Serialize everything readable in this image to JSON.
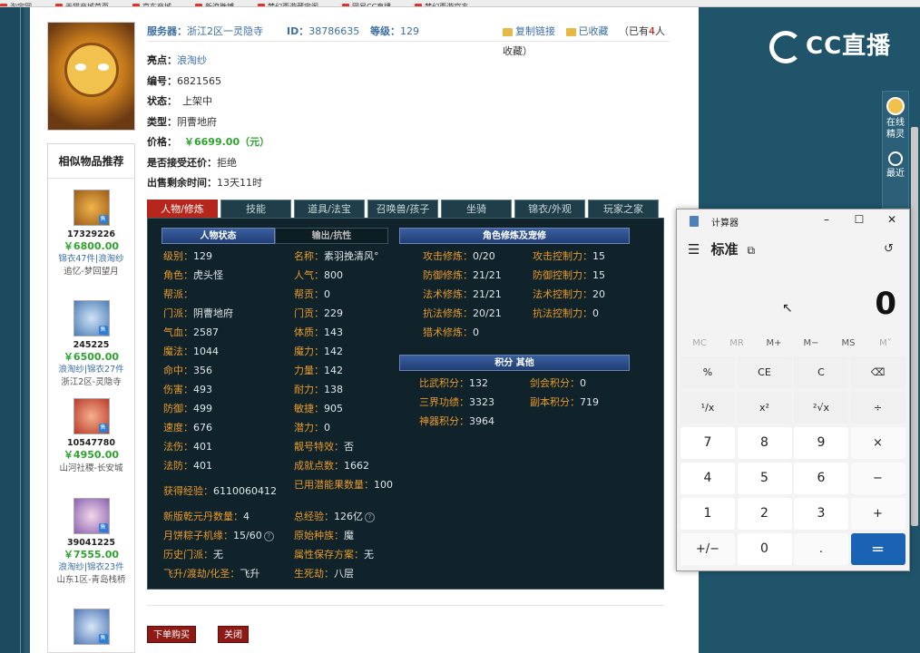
{
  "bookmarks": [
    {
      "label": "淘宝网"
    },
    {
      "label": "天猫商城首页"
    },
    {
      "label": "京东商城"
    },
    {
      "label": "新浪微博"
    },
    {
      "label": "梦幻西游藏宝阁"
    },
    {
      "label": "网易CC直播"
    },
    {
      "label": "梦幻西游官方"
    }
  ],
  "info": {
    "server_label": "服务器：",
    "server_value": "浙江2区一灵隐寺",
    "id_label": "ID：",
    "id_value": "38786635",
    "level_label": "等级：",
    "level_value": "129",
    "copy_link": "复制链接",
    "favorited": "已收藏",
    "fav_count_pre": "（已有",
    "fav_count_num": "4",
    "fav_count_post": "人收藏）",
    "highlight_label": "亮点：",
    "highlight_value": "浪淘纱",
    "number_label": "编号：",
    "number_value": "6821565",
    "status_label": "状态：",
    "status_value": "上架中",
    "type_label": "类型：",
    "type_value": "阴曹地府",
    "price_label": "价格：",
    "price_value": "￥6699.00（元）",
    "counter_label": "是否接受还价：",
    "counter_value": "拒绝",
    "remain_label": "出售剩余时间：",
    "remain_value": "13天11时"
  },
  "sidebar": {
    "title": "相似物品推荐",
    "items": [
      {
        "id": "17329226",
        "price": "￥6800.00",
        "tag": "锦衣47件|浪淘纱",
        "server": "追忆-梦回望月"
      },
      {
        "id": "245225",
        "price": "￥6500.00",
        "tag": "浪淘纱|锦衣27件",
        "server": "浙江2区-灵隐寺"
      },
      {
        "id": "10547780",
        "price": "￥4950.00",
        "tag": "",
        "server": "山河社稷-长安城"
      },
      {
        "id": "39041225",
        "price": "￥7555.00",
        "tag": "浪淘纱|锦衣23件",
        "server": "山东1区-青岛栈桥"
      },
      {
        "id": "",
        "price": "",
        "tag": "",
        "server": ""
      }
    ],
    "sold_badge": "售"
  },
  "tabs": [
    "人物/修炼",
    "技能",
    "道具/法宝",
    "召唤兽/孩子",
    "坐骑",
    "锦衣/外观",
    "玩家之家"
  ],
  "panel": {
    "sec_status": "人物状态",
    "sec_output": "输出/抗性",
    "sec_cultivation": "角色修炼及宠修",
    "sec_score": "积分 其他",
    "left_stats": [
      {
        "k": "级别：",
        "v": "129"
      },
      {
        "k": "角色：",
        "v": "虎头怪"
      },
      {
        "k": "帮派：",
        "v": ""
      },
      {
        "k": "门派：",
        "v": "阴曹地府"
      },
      {
        "k": "气血：",
        "v": "2587"
      },
      {
        "k": "魔法：",
        "v": "1044"
      },
      {
        "k": "命中：",
        "v": "356"
      },
      {
        "k": "伤害：",
        "v": "493"
      },
      {
        "k": "防御：",
        "v": "499"
      },
      {
        "k": "速度：",
        "v": "676"
      },
      {
        "k": "法伤：",
        "v": "401"
      },
      {
        "k": "法防：",
        "v": "401"
      }
    ],
    "mid_stats": [
      {
        "k": "名称：",
        "v": "素羽挽清风°"
      },
      {
        "k": "人气：",
        "v": "800"
      },
      {
        "k": "帮贡：",
        "v": "0"
      },
      {
        "k": "门贡：",
        "v": "229"
      },
      {
        "k": "体质：",
        "v": "143"
      },
      {
        "k": "魔力：",
        "v": "142"
      },
      {
        "k": "力量：",
        "v": "142"
      },
      {
        "k": "耐力：",
        "v": "138"
      },
      {
        "k": "敏捷：",
        "v": "905"
      },
      {
        "k": "潜力：",
        "v": "0"
      },
      {
        "k": "靓号特效：",
        "v": "否"
      },
      {
        "k": "成就点数：",
        "v": "1662"
      }
    ],
    "exp_label": "获得经验：",
    "exp_value": "6110060412",
    "potential_label": "已用潜能果数量：",
    "potential_value": "100",
    "qiankun_label": "新版乾元丹数量：",
    "qiankun_value": "4",
    "total_exp_label": "总经验：",
    "total_exp_value": "126亿",
    "moon_label": "月饼粽子机缘：",
    "moon_value": "15/60",
    "race_label": "原始种族：",
    "race_value": "魔",
    "history_label": "历史门派：",
    "history_value": "无",
    "attr_save_label": "属性保存方案：",
    "attr_save_value": "无",
    "ascend_label": "飞升/渡劫/化圣：",
    "ascend_value": "飞升",
    "life_label": "生死劫：",
    "life_value": "八层",
    "cult_left": [
      {
        "k": "攻击修炼：",
        "v": "0/20"
      },
      {
        "k": "防御修炼：",
        "v": "21/21"
      },
      {
        "k": "法术修炼：",
        "v": "21/21"
      },
      {
        "k": "抗法修炼：",
        "v": "20/21"
      },
      {
        "k": "猎术修炼：",
        "v": "0"
      }
    ],
    "cult_right": [
      {
        "k": "攻击控制力：",
        "v": "15"
      },
      {
        "k": "防御控制力：",
        "v": "15"
      },
      {
        "k": "法术控制力：",
        "v": "20"
      },
      {
        "k": "抗法控制力：",
        "v": "0"
      }
    ],
    "score_rows": [
      {
        "k": "比武积分：",
        "v": "132"
      },
      {
        "k": "三界功绩：",
        "v": "3323"
      },
      {
        "k": "神器积分：",
        "v": "3964"
      }
    ],
    "score_right": [
      {
        "k": "剑会积分：",
        "v": "0"
      },
      {
        "k": "副本积分：",
        "v": "719"
      }
    ]
  },
  "buttons": {
    "buy": "下单购买",
    "close": "关闭"
  },
  "right_panel": {
    "logo": "CC直播",
    "online_sprite": "在线精灵",
    "recent": "最近"
  },
  "calculator": {
    "title": "计算器",
    "mode": "标准",
    "display": "0",
    "memory": [
      "MC",
      "MR",
      "M+",
      "M−",
      "MS",
      "M˅"
    ],
    "keys": [
      [
        "%",
        "CE",
        "C",
        "⌫"
      ],
      [
        "¹/x",
        "x²",
        "²√x",
        "÷"
      ],
      [
        "7",
        "8",
        "9",
        "×"
      ],
      [
        "4",
        "5",
        "6",
        "−"
      ],
      [
        "1",
        "2",
        "3",
        "+"
      ],
      [
        "+/−",
        "0",
        ".",
        "="
      ]
    ]
  },
  "colors": {
    "accent_red": "#b5271c",
    "price_green": "#2ea42e",
    "link_blue": "#3a6ea5",
    "panel_bg": "#10232b",
    "calc_equal": "#1a63b4"
  }
}
